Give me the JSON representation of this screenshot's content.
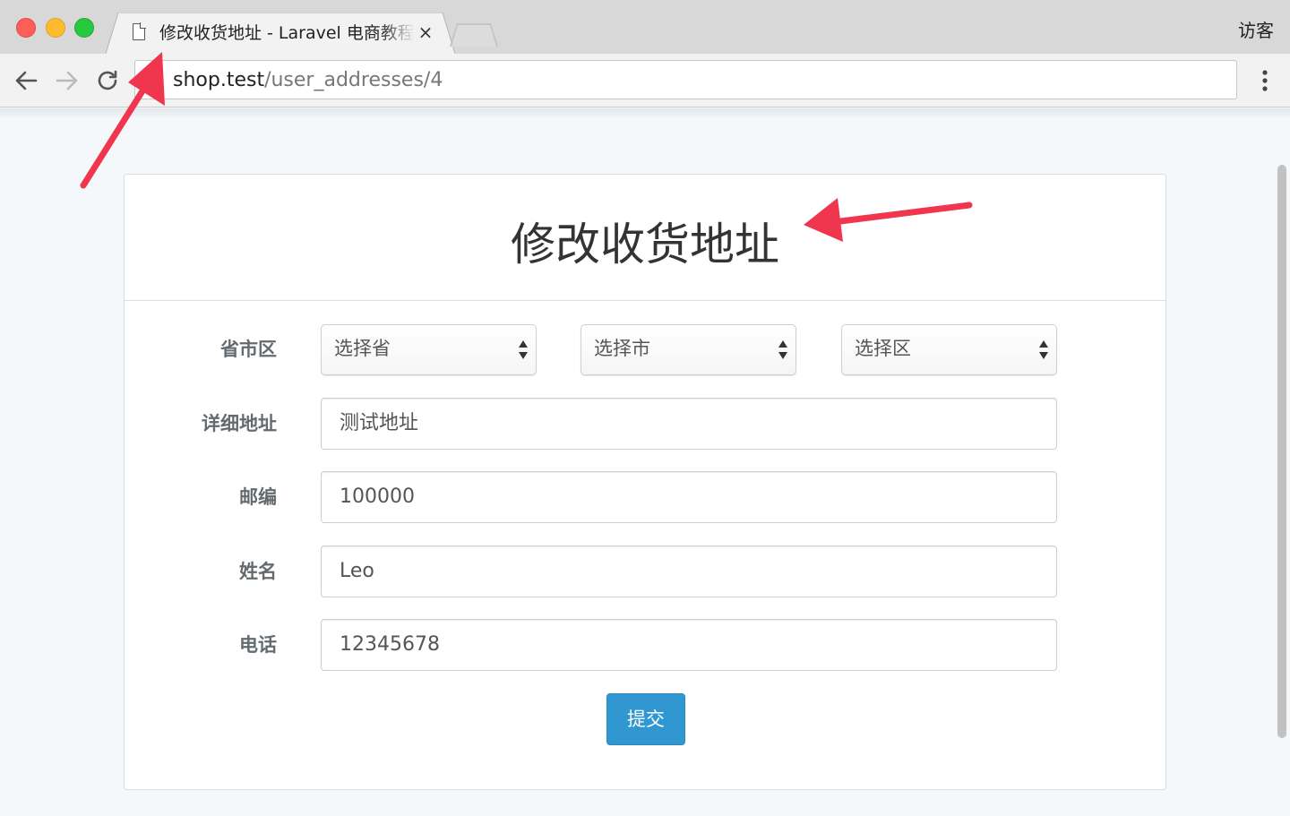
{
  "browser": {
    "tab_title": "修改收货地址 - Laravel 电商教程",
    "tab_close": "×",
    "guest_label": "访客",
    "url_host": "shop.test",
    "url_path": "/user_addresses/4",
    "nav": {
      "back_icon": "arrow-left-icon",
      "forward_icon": "arrow-right-icon",
      "reload_icon": "reload-icon",
      "menu_icon": "vertical-dots-icon"
    }
  },
  "page": {
    "title": "修改收货地址",
    "form": {
      "region_label": "省市区",
      "province_select": "选择省",
      "city_select": "选择市",
      "district_select": "选择区",
      "address_label": "详细地址",
      "address_value": "测试地址",
      "zip_label": "邮编",
      "zip_value": "100000",
      "name_label": "姓名",
      "name_value": "Leo",
      "phone_label": "电话",
      "phone_value": "12345678",
      "submit_label": "提交"
    }
  },
  "colors": {
    "primary_button": "#3097d1",
    "annotation_arrow": "#f0364f",
    "panel_border": "#d3e0e9",
    "page_background": "#f5f8fa"
  }
}
